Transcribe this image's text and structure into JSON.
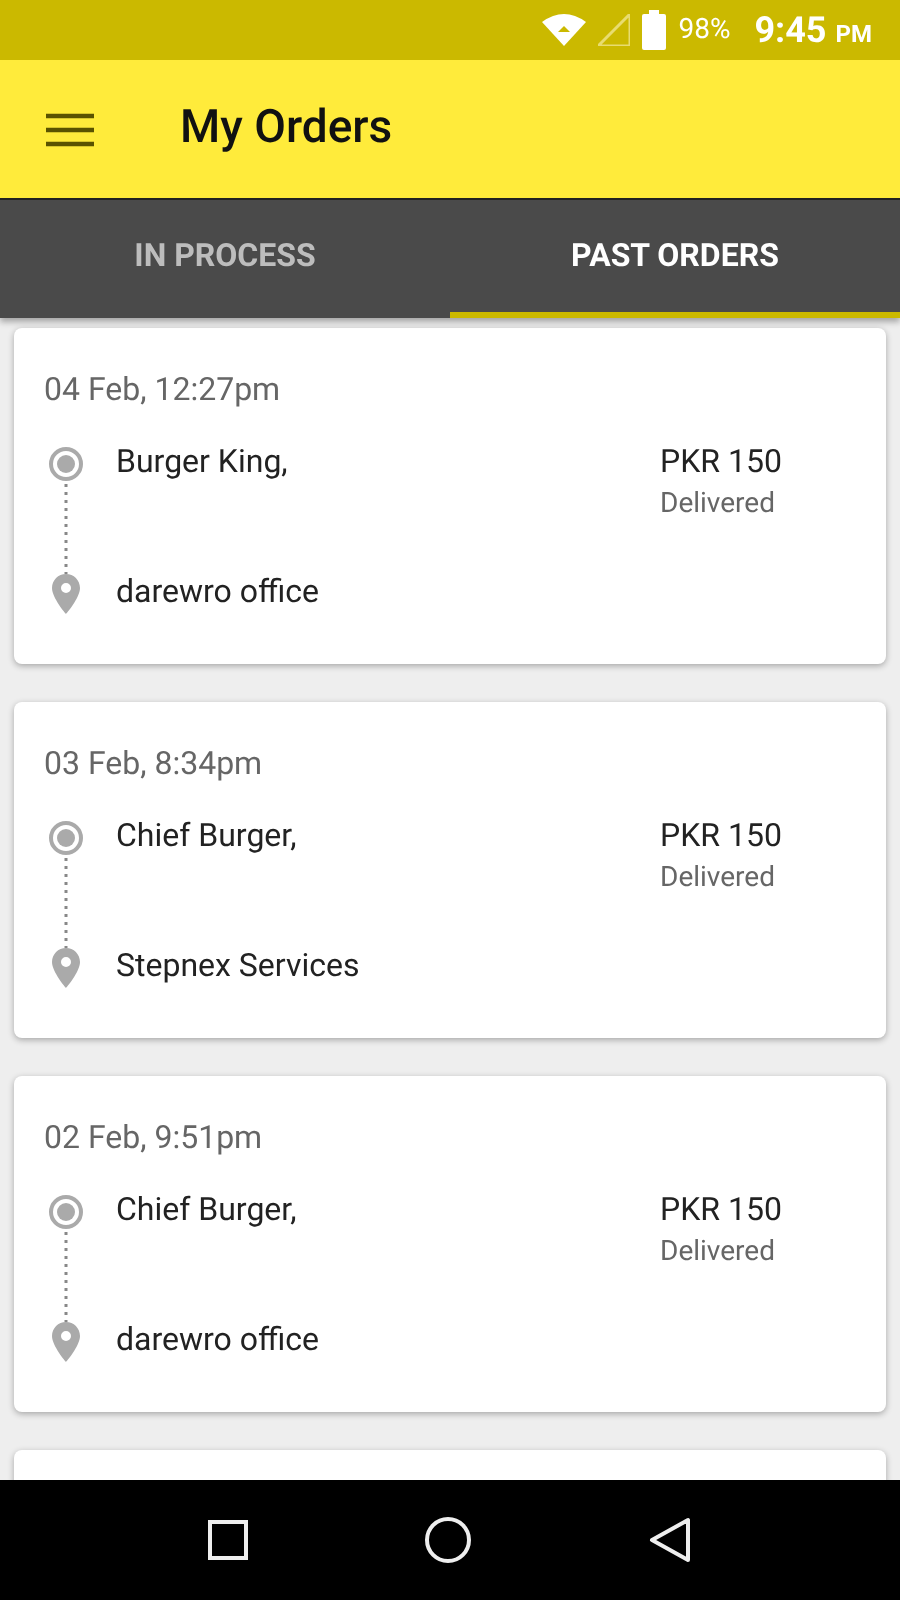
{
  "status_bar": {
    "battery": "98%",
    "time": "9:45",
    "ampm": "PM"
  },
  "app_bar": {
    "title": "My Orders"
  },
  "tabs": [
    {
      "label": "IN PROCESS",
      "selected": false
    },
    {
      "label": "PAST ORDERS",
      "selected": true
    }
  ],
  "orders": [
    {
      "date": "04 Feb, 12:27pm",
      "pickup": "Burger King,",
      "dropoff": "darewro office",
      "price": "PKR 150",
      "status": "Delivered"
    },
    {
      "date": "03 Feb, 8:34pm",
      "pickup": "Chief Burger,",
      "dropoff": "Stepnex Services",
      "price": "PKR 150",
      "status": "Delivered"
    },
    {
      "date": "02 Feb, 9:51pm",
      "pickup": "Chief Burger,",
      "dropoff": "darewro office",
      "price": "PKR 150",
      "status": "Delivered"
    }
  ]
}
